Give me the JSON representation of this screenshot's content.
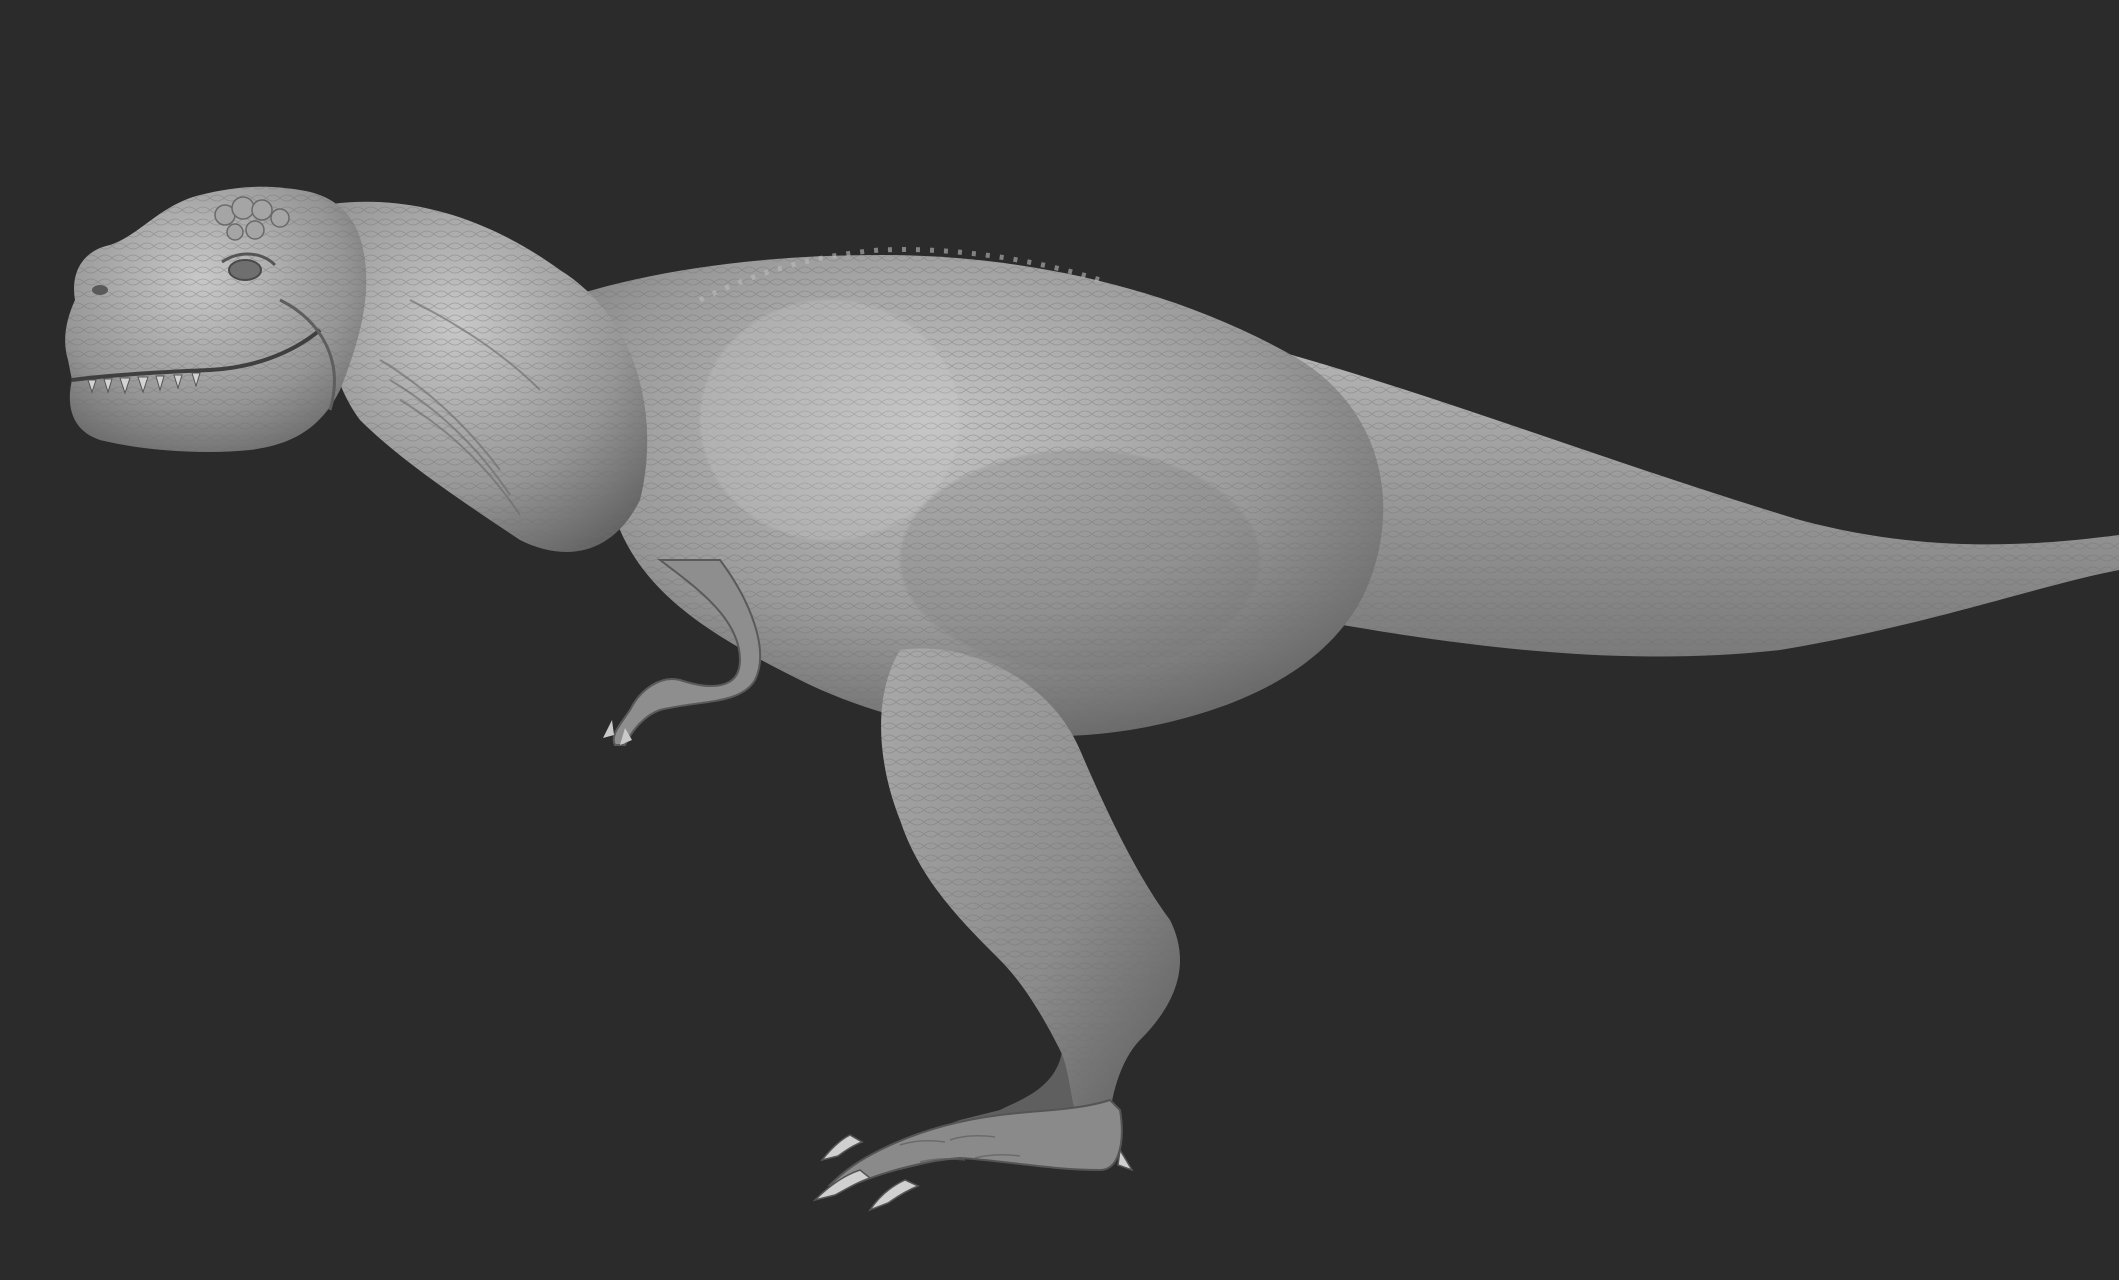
{
  "scene": {
    "subject": "t-rex-sculpt",
    "background_color": "#2b2b2b",
    "clay_color_light": "#b9b9b9",
    "clay_color_mid": "#8a8a8a",
    "clay_color_dark": "#4a4a4a"
  }
}
